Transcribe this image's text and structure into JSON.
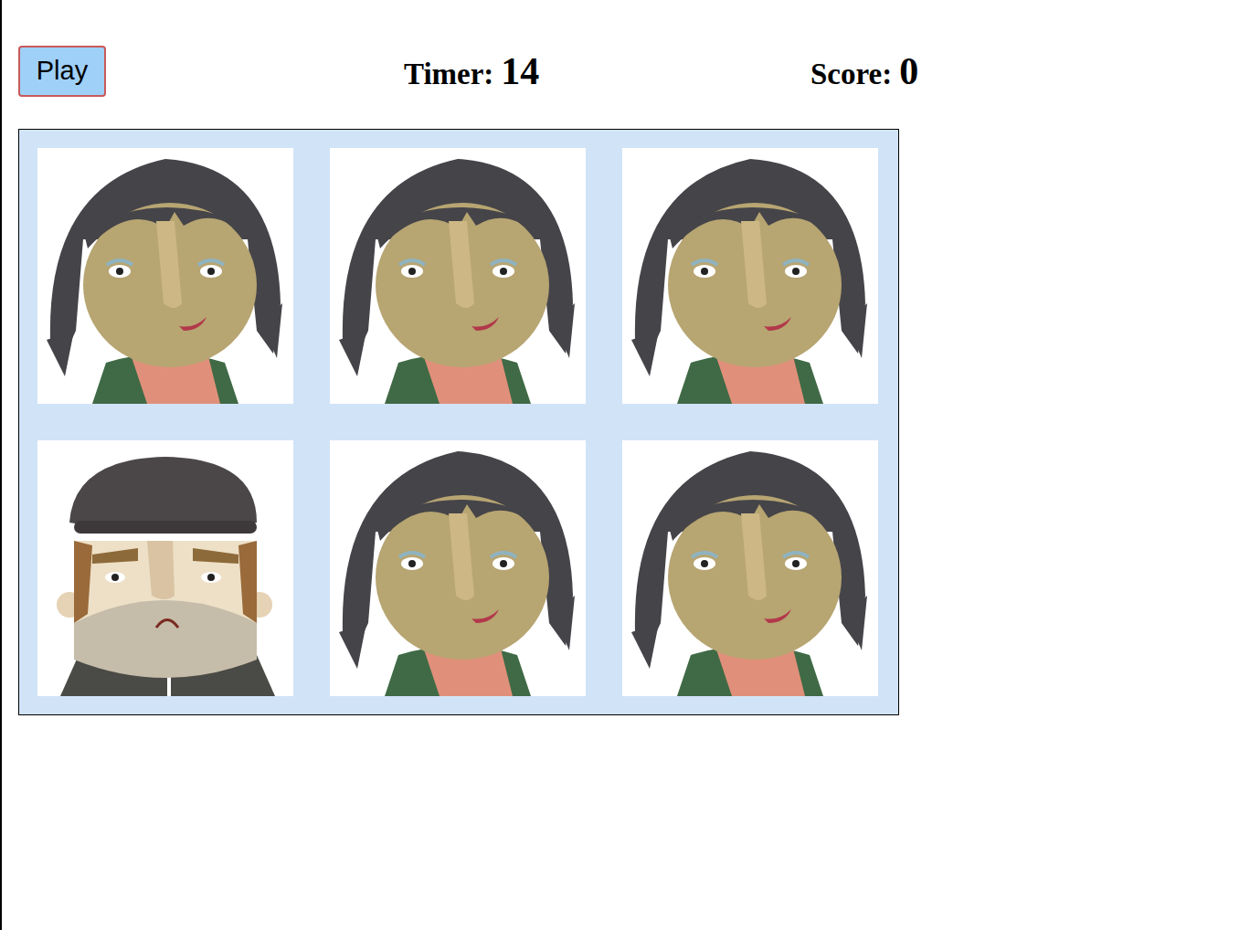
{
  "controls": {
    "play_button": "Play"
  },
  "timer": {
    "label": "Timer:",
    "value": "14"
  },
  "score": {
    "label": "Score:",
    "value": "0"
  },
  "board": {
    "cells": [
      {
        "kind": "woman"
      },
      {
        "kind": "woman"
      },
      {
        "kind": "woman"
      },
      {
        "kind": "man"
      },
      {
        "kind": "woman"
      },
      {
        "kind": "woman"
      }
    ]
  }
}
